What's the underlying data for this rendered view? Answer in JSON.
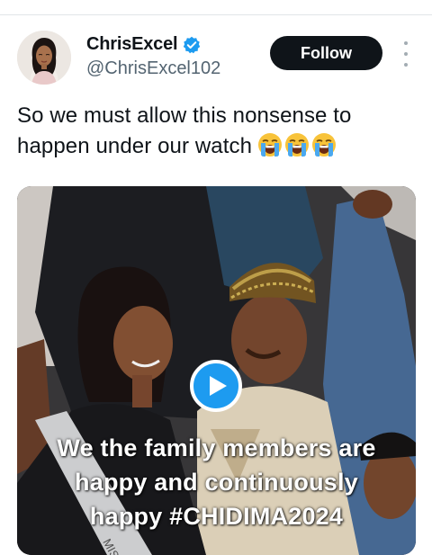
{
  "tweet": {
    "author": {
      "display_name": "ChrisExcel",
      "handle": "@ChrisExcel102",
      "verified": true
    },
    "follow_label": "Follow",
    "text": "So we must allow this nonsense to happen under our watch",
    "emojis": [
      "loudly-crying-face",
      "loudly-crying-face",
      "loudly-crying-face"
    ],
    "media": {
      "type": "video",
      "caption_lines": [
        "We the family members are",
        "happy and continuously",
        "happy #CHIDIMA2024"
      ],
      "sash_text": "MISS"
    }
  },
  "colors": {
    "follow_bg": "#0f1419",
    "verified_blue": "#1d9bf0",
    "play_blue": "#1d9bf0",
    "handle_gray": "#536471"
  }
}
